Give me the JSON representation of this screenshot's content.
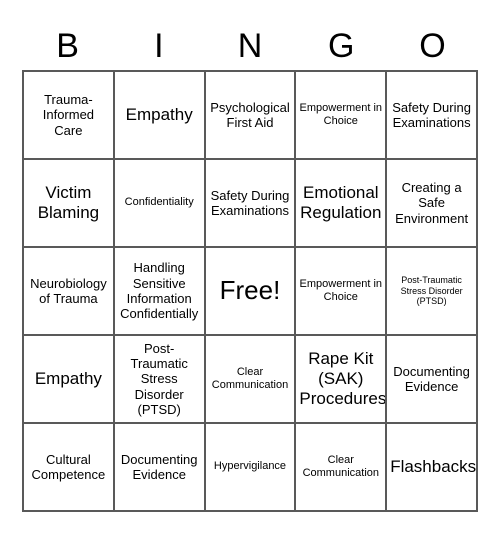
{
  "card": {
    "title_letters": [
      "B",
      "I",
      "N",
      "G",
      "O"
    ],
    "free_space_label": "Free!",
    "rows": [
      [
        {
          "label": "Trauma-Informed Care",
          "size": "md"
        },
        {
          "label": "Empathy",
          "size": "lg"
        },
        {
          "label": "Psychological First Aid",
          "size": "md"
        },
        {
          "label": "Empowerment in Choice",
          "size": "sm"
        },
        {
          "label": "Safety During Examinations",
          "size": "md"
        }
      ],
      [
        {
          "label": "Victim Blaming",
          "size": "lg"
        },
        {
          "label": "Confidentiality",
          "size": "sm"
        },
        {
          "label": "Safety During Examinations",
          "size": "md"
        },
        {
          "label": "Emotional Regulation",
          "size": "lg"
        },
        {
          "label": "Creating a Safe Environment",
          "size": "md"
        }
      ],
      [
        {
          "label": "Neurobiology of Trauma",
          "size": "md"
        },
        {
          "label": "Handling Sensitive Information Confidentially",
          "size": "md"
        },
        {
          "label": "Free!",
          "size": "xl"
        },
        {
          "label": "Empowerment in Choice",
          "size": "sm"
        },
        {
          "label": "Post-Traumatic Stress Disorder (PTSD)",
          "size": "xs"
        }
      ],
      [
        {
          "label": "Empathy",
          "size": "lg"
        },
        {
          "label": "Post-Traumatic Stress Disorder (PTSD)",
          "size": "md"
        },
        {
          "label": "Clear Communication",
          "size": "sm"
        },
        {
          "label": "Rape Kit (SAK) Procedures",
          "size": "lg"
        },
        {
          "label": "Documenting Evidence",
          "size": "md"
        }
      ],
      [
        {
          "label": "Cultural Competence",
          "size": "md"
        },
        {
          "label": "Documenting Evidence",
          "size": "md"
        },
        {
          "label": "Hypervigilance",
          "size": "sm"
        },
        {
          "label": "Clear Communication",
          "size": "sm"
        },
        {
          "label": "Flashbacks",
          "size": "lg"
        }
      ]
    ]
  },
  "colors": {
    "border": "#595959",
    "text": "#000000",
    "background": "#ffffff"
  }
}
